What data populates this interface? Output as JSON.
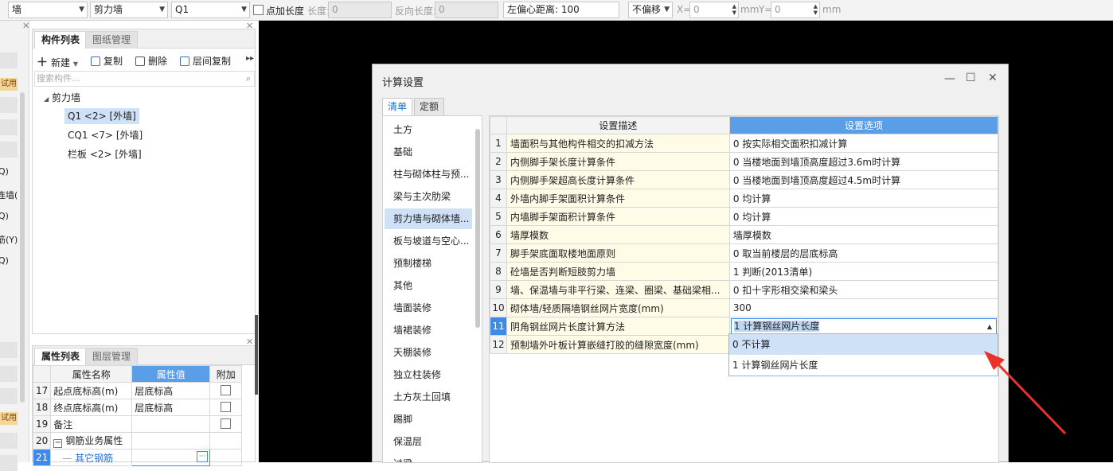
{
  "toolbar": {
    "floor_value": "墙",
    "type_value": "剪力墙",
    "component_value": "Q1",
    "add_length_label": "点加长度",
    "length_label": "长度:",
    "length_value": "0",
    "reverse_label": "反向长度:",
    "reverse_value": "0",
    "offset_label": "左偏心距离:",
    "offset_value": "100",
    "no_offset_value": "不偏移",
    "x_label": "X=",
    "x_value": "0",
    "x_unit": "mm",
    "y_label": "Y=",
    "y_value": "0",
    "y_unit": "mm"
  },
  "left_strip": {
    "trial1": "试用",
    "frag1": "Q)",
    "frag2": "连墙(",
    "frag3": "Q)",
    "frag4": "筋(Y)",
    "frag5": "Q)",
    "trial2": "试用"
  },
  "component_panel": {
    "tab_list": "构件列表",
    "tab_drawings": "图纸管理",
    "new": "新建",
    "copy": "复制",
    "delete": "删除",
    "floor_copy": "层间复制",
    "search_placeholder": "搜索构件...",
    "tree_root": "剪力墙",
    "tree_items": [
      "Q1 <2> [外墙]",
      "CQ1 <7> [外墙]",
      "栏板 <2> [外墙]"
    ]
  },
  "property_panel": {
    "tab_props": "属性列表",
    "tab_layers": "图层管理",
    "headers": [
      "属性名称",
      "属性值",
      "附加"
    ],
    "rows": [
      {
        "num": "17",
        "name": "起点底标高(m)",
        "value": "层底标高"
      },
      {
        "num": "18",
        "name": "终点底标高(m)",
        "value": "层底标高"
      },
      {
        "num": "19",
        "name": "备注",
        "value": ""
      },
      {
        "num": "20",
        "name": "钢筋业务属性",
        "value": ""
      },
      {
        "num": "21",
        "name": "其它钢筋",
        "value": ""
      }
    ],
    "more_button": "···"
  },
  "dialog": {
    "title": "计算设置",
    "tab_list": "清单",
    "tab_quota": "定额",
    "categories": [
      "土方",
      "基础",
      "柱与砌体柱与预...",
      "梁与主次肋梁",
      "剪力墙与砌体墙...",
      "板与坡道与空心...",
      "预制楼梯",
      "其他",
      "墙面装修",
      "墙裙装修",
      "天棚装修",
      "独立柱装修",
      "土方灰土回填",
      "踢脚",
      "保温层",
      "过梁"
    ],
    "grid_headers": [
      "设置描述",
      "设置选项"
    ],
    "rows": [
      {
        "num": "1",
        "desc": "墙面积与其他构件相交的扣减方法",
        "opt": "0 按实际相交面积扣减计算"
      },
      {
        "num": "2",
        "desc": "内侧脚手架长度计算条件",
        "opt": "0 当楼地面到墙顶高度超过3.6m时计算"
      },
      {
        "num": "3",
        "desc": "内侧脚手架超高长度计算条件",
        "opt": "0 当楼地面到墙顶高度超过4.5m时计算"
      },
      {
        "num": "4",
        "desc": "外墙内脚手架面积计算条件",
        "opt": "0 均计算"
      },
      {
        "num": "5",
        "desc": "内墙脚手架面积计算条件",
        "opt": "0 均计算"
      },
      {
        "num": "6",
        "desc": "墙厚模数",
        "opt": "墙厚模数"
      },
      {
        "num": "7",
        "desc": "脚手架底面取楼地面原则",
        "opt": "0 取当前楼层的层底标高"
      },
      {
        "num": "8",
        "desc": "砼墙是否判断短肢剪力墙",
        "opt": "1 判断(2013清单)"
      },
      {
        "num": "9",
        "desc": "墙、保温墙与非平行梁、连梁、圈梁、基础梁相...",
        "opt": "0 扣十字形相交梁和梁头"
      },
      {
        "num": "10",
        "desc": "砌体墙/轻质隔墙钢丝网片宽度(mm)",
        "opt": "300"
      },
      {
        "num": "11",
        "desc": "阴角钢丝网片长度计算方法",
        "opt": "1 计算钢丝网片长度"
      },
      {
        "num": "12",
        "desc": "预制墙外叶板计算嵌缝打胶的缝隙宽度(mm)",
        "opt": ""
      }
    ],
    "dropdown_options": [
      "0 不计算",
      "1 计算钢丝网片长度"
    ]
  },
  "colors": {
    "accent": "#5b9ee8",
    "selection": "#cfe1f7",
    "arrow": "#e8332a"
  }
}
